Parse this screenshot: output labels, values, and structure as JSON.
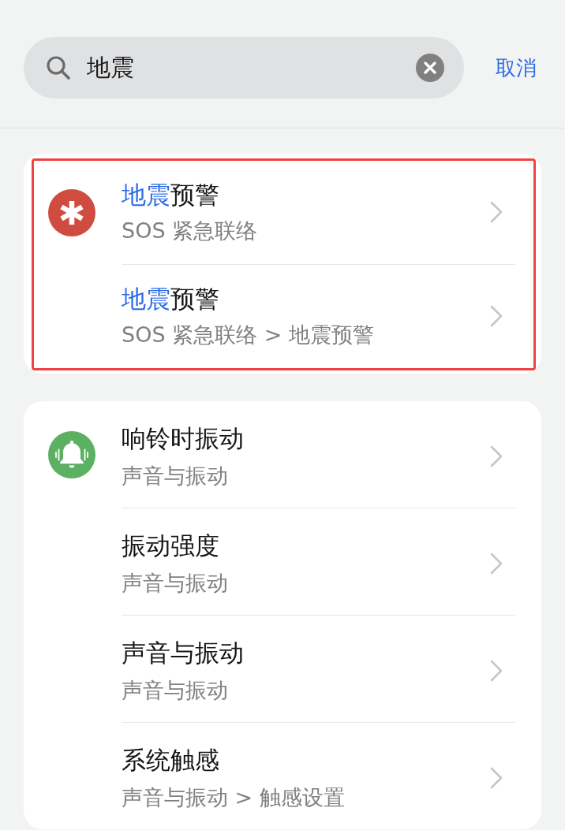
{
  "search": {
    "value": "地震",
    "action": "取消"
  },
  "groups": [
    {
      "highlighted": true,
      "items": [
        {
          "title_parts": [
            {
              "text": "地震",
              "matched": true
            },
            {
              "text": "预警",
              "matched": false
            }
          ],
          "path": "SOS 紧急联络"
        },
        {
          "title_parts": [
            {
              "text": "地震",
              "matched": true
            },
            {
              "text": "预警",
              "matched": false
            }
          ],
          "path": "SOS 紧急联络 > 地震预警"
        }
      ]
    },
    {
      "highlighted": false,
      "items": [
        {
          "title_parts": [
            {
              "text": "响铃时振动",
              "matched": false
            }
          ],
          "path": "声音与振动"
        },
        {
          "title_parts": [
            {
              "text": "振动强度",
              "matched": false
            }
          ],
          "path": "声音与振动"
        },
        {
          "title_parts": [
            {
              "text": "声音与振动",
              "matched": false
            }
          ],
          "path": "声音与振动"
        },
        {
          "title_parts": [
            {
              "text": "系统触感",
              "matched": false
            }
          ],
          "path": "声音与振动 > 触感设置"
        }
      ]
    }
  ]
}
